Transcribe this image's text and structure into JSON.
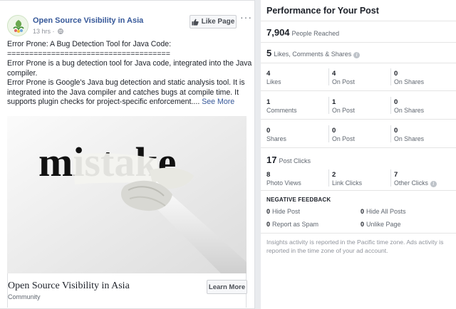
{
  "post": {
    "page_name": "Open Source Visibility in Asia",
    "time": "13 hrs",
    "time_sep": "·",
    "like_page_label": "Like Page",
    "more_label": "···",
    "text_lines": [
      "Error Prone: A Bug Detection Tool for Java Code:",
      "=====================================",
      "Error Prone is a bug detection tool for Java code, integrated into the Java",
      "compiler.",
      "Error Prone is Google's Java bug detection and static analysis tool. It is",
      "integrated into the Java compiler and catches bugs at compile time. It",
      "supports plugin checks for project-specific enforcement...."
    ],
    "see_more": "See More",
    "image_word": "mistake",
    "link_title": "Open Source Visibility in Asia",
    "link_category": "Community",
    "learn_more_label": "Learn More"
  },
  "insights": {
    "title": "Performance for Your Post",
    "reached_num": "7,904",
    "reached_label": "People Reached",
    "engagement_num": "5",
    "engagement_label": "Likes, Comments & Shares",
    "rows": [
      [
        {
          "n": "4",
          "l": "Likes"
        },
        {
          "n": "4",
          "l": "On Post"
        },
        {
          "n": "0",
          "l": "On Shares"
        }
      ],
      [
        {
          "n": "1",
          "l": "Comments"
        },
        {
          "n": "1",
          "l": "On Post"
        },
        {
          "n": "0",
          "l": "On Shares"
        }
      ],
      [
        {
          "n": "0",
          "l": "Shares"
        },
        {
          "n": "0",
          "l": "On Post"
        },
        {
          "n": "0",
          "l": "On Shares"
        }
      ]
    ],
    "clicks_num": "17",
    "clicks_label": "Post Clicks",
    "clicks": [
      {
        "n": "8",
        "l": "Photo Views"
      },
      {
        "n": "2",
        "l": "Link Clicks"
      },
      {
        "n": "7",
        "l": "Other Clicks"
      }
    ],
    "negative_title": "NEGATIVE FEEDBACK",
    "negative": [
      {
        "n": "0",
        "l": "Hide Post"
      },
      {
        "n": "0",
        "l": "Hide All Posts"
      },
      {
        "n": "0",
        "l": "Report as Spam"
      },
      {
        "n": "0",
        "l": "Unlike Page"
      }
    ],
    "footnote": "Insights activity is reported in the Pacific time zone. Ads activity is reported in the time zone of your ad account."
  },
  "colors": {
    "link_blue": "#365899",
    "muted": "#606770",
    "background": "#e9ebee"
  }
}
